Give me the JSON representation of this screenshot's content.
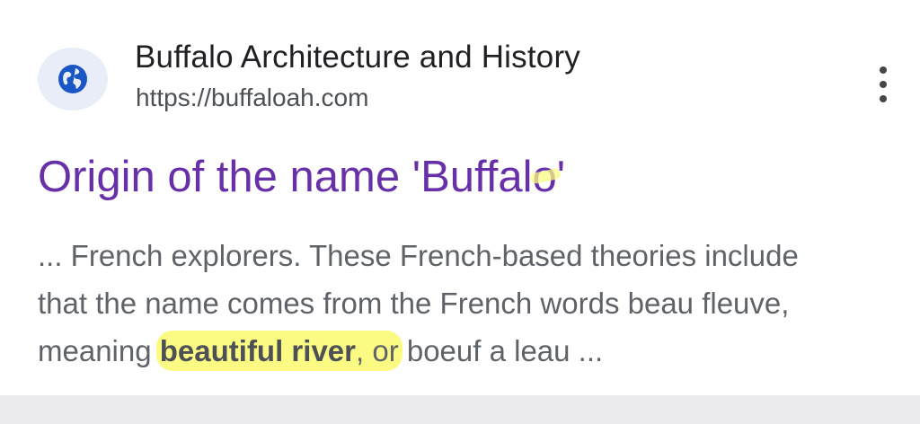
{
  "site": {
    "name": "Buffalo Architecture and History",
    "url": "https://buffaloah.com",
    "favicon": "globe-icon",
    "favicon_color": "#1a56c4"
  },
  "result": {
    "title": "Origin of the name 'Buffalo'",
    "title_color": "#6830a8",
    "snippet_line1": "... French explorers. These French-based theories include",
    "snippet_line2": "that the name comes from the French words beau fleuve,",
    "snippet_line3_pre": "meaning ",
    "snippet_line3_bold": "beautiful river",
    "snippet_line3_hl_tail": ", or",
    "snippet_line3_post": " boeuf a leau ..."
  },
  "menu": {
    "icon": "more-vert-icon"
  },
  "colors": {
    "highlight": "#fbfb83"
  }
}
